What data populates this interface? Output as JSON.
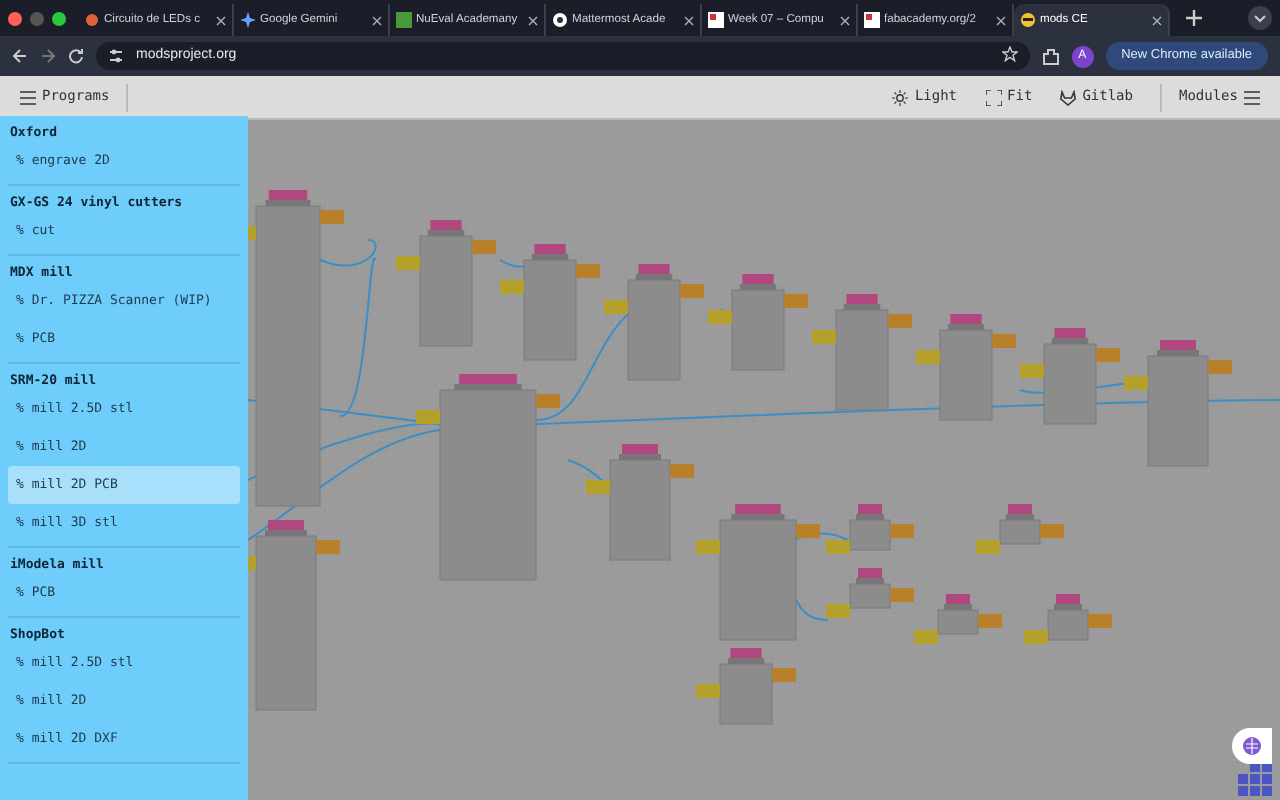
{
  "browser": {
    "tabs": [
      {
        "title": "Circuito de LEDs c",
        "selected": false
      },
      {
        "title": "Google Gemini",
        "selected": false
      },
      {
        "title": "NuEval Academany",
        "selected": false
      },
      {
        "title": "Mattermost Acade",
        "selected": false
      },
      {
        "title": "Week 07 – Compu",
        "selected": false
      },
      {
        "title": "fabacademy.org/2",
        "selected": false
      },
      {
        "title": "mods CE",
        "selected": true
      }
    ],
    "address": "modsproject.org",
    "profile": "A",
    "update_button": "New Chrome available"
  },
  "toolbar": {
    "programs": "Programs",
    "actions": [
      "Light",
      "Fit",
      "Gitlab"
    ],
    "modules": "Modules"
  },
  "sidebar": {
    "groups": [
      {
        "title": "Oxford",
        "items": [
          {
            "glyph": "%",
            "label": "engrave 2D",
            "selected": false
          }
        ]
      },
      {
        "title": "GX-GS 24 vinyl cutters",
        "items": [
          {
            "glyph": "%",
            "label": "cut",
            "selected": false
          }
        ]
      },
      {
        "title": "MDX mill",
        "items": [
          {
            "glyph": "%",
            "label": "Dr. PIZZA Scanner (WIP)",
            "selected": false
          },
          {
            "glyph": "%",
            "label": "PCB",
            "selected": false
          }
        ]
      },
      {
        "title": "SRM-20 mill",
        "items": [
          {
            "glyph": "%",
            "label": "mill 2.5D stl",
            "selected": false
          },
          {
            "glyph": "%",
            "label": "mill 2D",
            "selected": false
          },
          {
            "glyph": "%",
            "label": "mill 2D PCB",
            "selected": true
          },
          {
            "glyph": "%",
            "label": "mill 3D stl",
            "selected": false
          }
        ]
      },
      {
        "title": "iModela mill",
        "items": [
          {
            "glyph": "%",
            "label": "PCB",
            "selected": false
          }
        ]
      },
      {
        "title": "ShopBot",
        "items": [
          {
            "glyph": "%",
            "label": "mill 2.5D stl",
            "selected": false
          },
          {
            "glyph": "%",
            "label": "mill 2D",
            "selected": false
          },
          {
            "glyph": "%",
            "label": "mill 2D DXF",
            "selected": false
          }
        ]
      }
    ]
  }
}
